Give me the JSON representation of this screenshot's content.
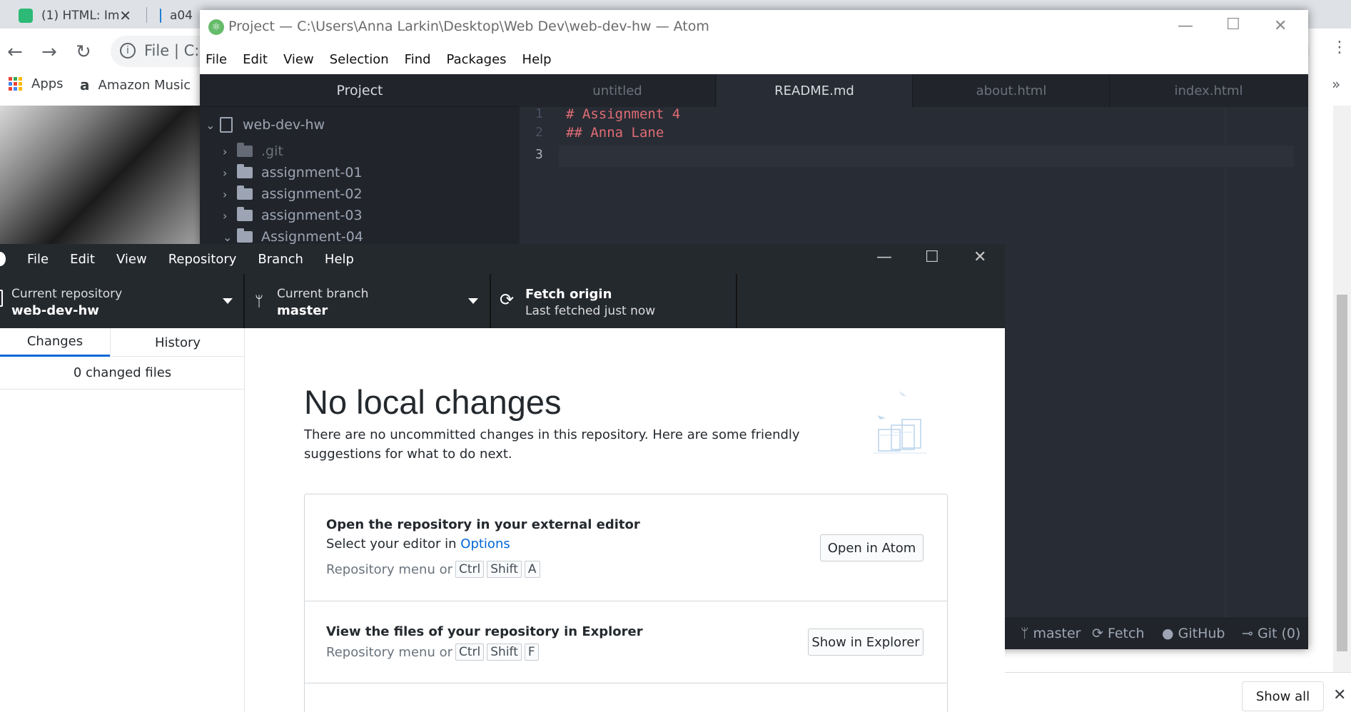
{
  "browser": {
    "tabs": [
      {
        "label": "(1) HTML: Im",
        "icon_color": "#2db976"
      },
      {
        "label": "a04",
        "icon_color": "#1f7fd6"
      }
    ],
    "nav": {
      "back": "←",
      "forward": "→",
      "reload": "↻"
    },
    "address_text": "File  |  C:",
    "bookmarks": [
      {
        "label": "Apps",
        "icon": "apps-grid-icon"
      },
      {
        "label": "Amazon Music",
        "icon": "amazon-icon"
      }
    ],
    "download_bar": {
      "show_all_label": "Show all",
      "close": "✕"
    },
    "overflow_chevron": "»"
  },
  "atom": {
    "title": "Project — C:\\Users\\Anna Larkin\\Desktop\\Web Dev\\web-dev-hw — Atom",
    "menu": [
      "File",
      "Edit",
      "View",
      "Selection",
      "Find",
      "Packages",
      "Help"
    ],
    "tree_header": "Project",
    "tree": {
      "root": "web-dev-hw",
      "items": [
        ".git",
        "assignment-01",
        "assignment-02",
        "assignment-03",
        "Assignment-04"
      ]
    },
    "tabs": [
      "untitled",
      "README.md",
      "about.html",
      "index.html"
    ],
    "active_tab_index": 1,
    "lines": [
      {
        "num": "1",
        "text": "# Assignment 4"
      },
      {
        "num": "2",
        "text": "## Anna Lane"
      },
      {
        "num": "3",
        "text": ""
      }
    ],
    "status": {
      "branch": "master",
      "fetch": "Fetch",
      "github": "GitHub",
      "git": "Git (0)"
    },
    "window_buttons": {
      "minimize": "—",
      "maximize": "☐",
      "close": "✕"
    }
  },
  "github_desktop": {
    "menu": [
      "File",
      "Edit",
      "View",
      "Repository",
      "Branch",
      "Help"
    ],
    "window_buttons": {
      "minimize": "—",
      "maximize": "☐",
      "close": "✕"
    },
    "toolbar": {
      "repo_label": "Current repository",
      "repo_value": "web-dev-hw",
      "branch_label": "Current branch",
      "branch_value": "master",
      "fetch_label": "Fetch origin",
      "fetch_sub": "Last fetched just now"
    },
    "sidebar": {
      "tabs": [
        "Changes",
        "History"
      ],
      "active_tab_index": 0,
      "changed_files": "0 changed files"
    },
    "main": {
      "heading": "No local changes",
      "description": "There are no uncommitted changes in this repository. Here are some friendly suggestions for what to do next.",
      "suggestions": [
        {
          "title": "Open the repository in your external editor",
          "sub_prefix": "Select your editor in ",
          "sub_link": "Options",
          "keys_prefix": "Repository menu or",
          "keys": [
            "Ctrl",
            "Shift",
            "A"
          ],
          "button": "Open in Atom"
        },
        {
          "title": "View the files of your repository in Explorer",
          "keys_prefix": "Repository menu or",
          "keys": [
            "Ctrl",
            "Shift",
            "F"
          ],
          "button": "Show in Explorer"
        }
      ]
    }
  },
  "colors": {
    "atom_bg": "#21252b",
    "editor_bg": "#282c34",
    "markdown_heading": "#e06c75",
    "gh_dark": "#24292e",
    "gh_link": "#0366d6"
  }
}
